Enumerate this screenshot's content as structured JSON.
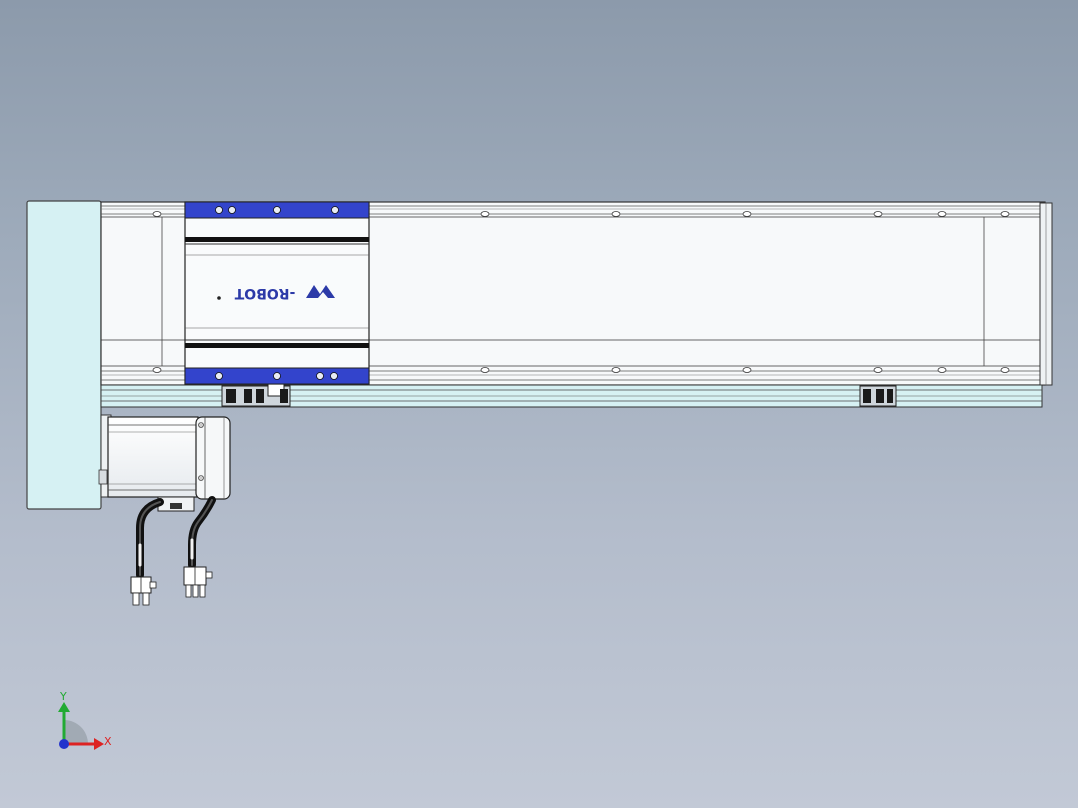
{
  "viewport": {
    "background_top": "#8c9aab",
    "background_bottom": "#c2c9d6"
  },
  "model": {
    "frame_color": "#d6f1f3",
    "rail_color": "#f7f9fa",
    "carriage_accent": "#3344cc",
    "logo_text": "-ROBOT",
    "logo_color": "#2c3aa8"
  },
  "triad": {
    "x_label": "X",
    "y_label": "Y",
    "x_color": "#dd2222",
    "y_color": "#22aa33",
    "origin_color": "#2233cc"
  }
}
